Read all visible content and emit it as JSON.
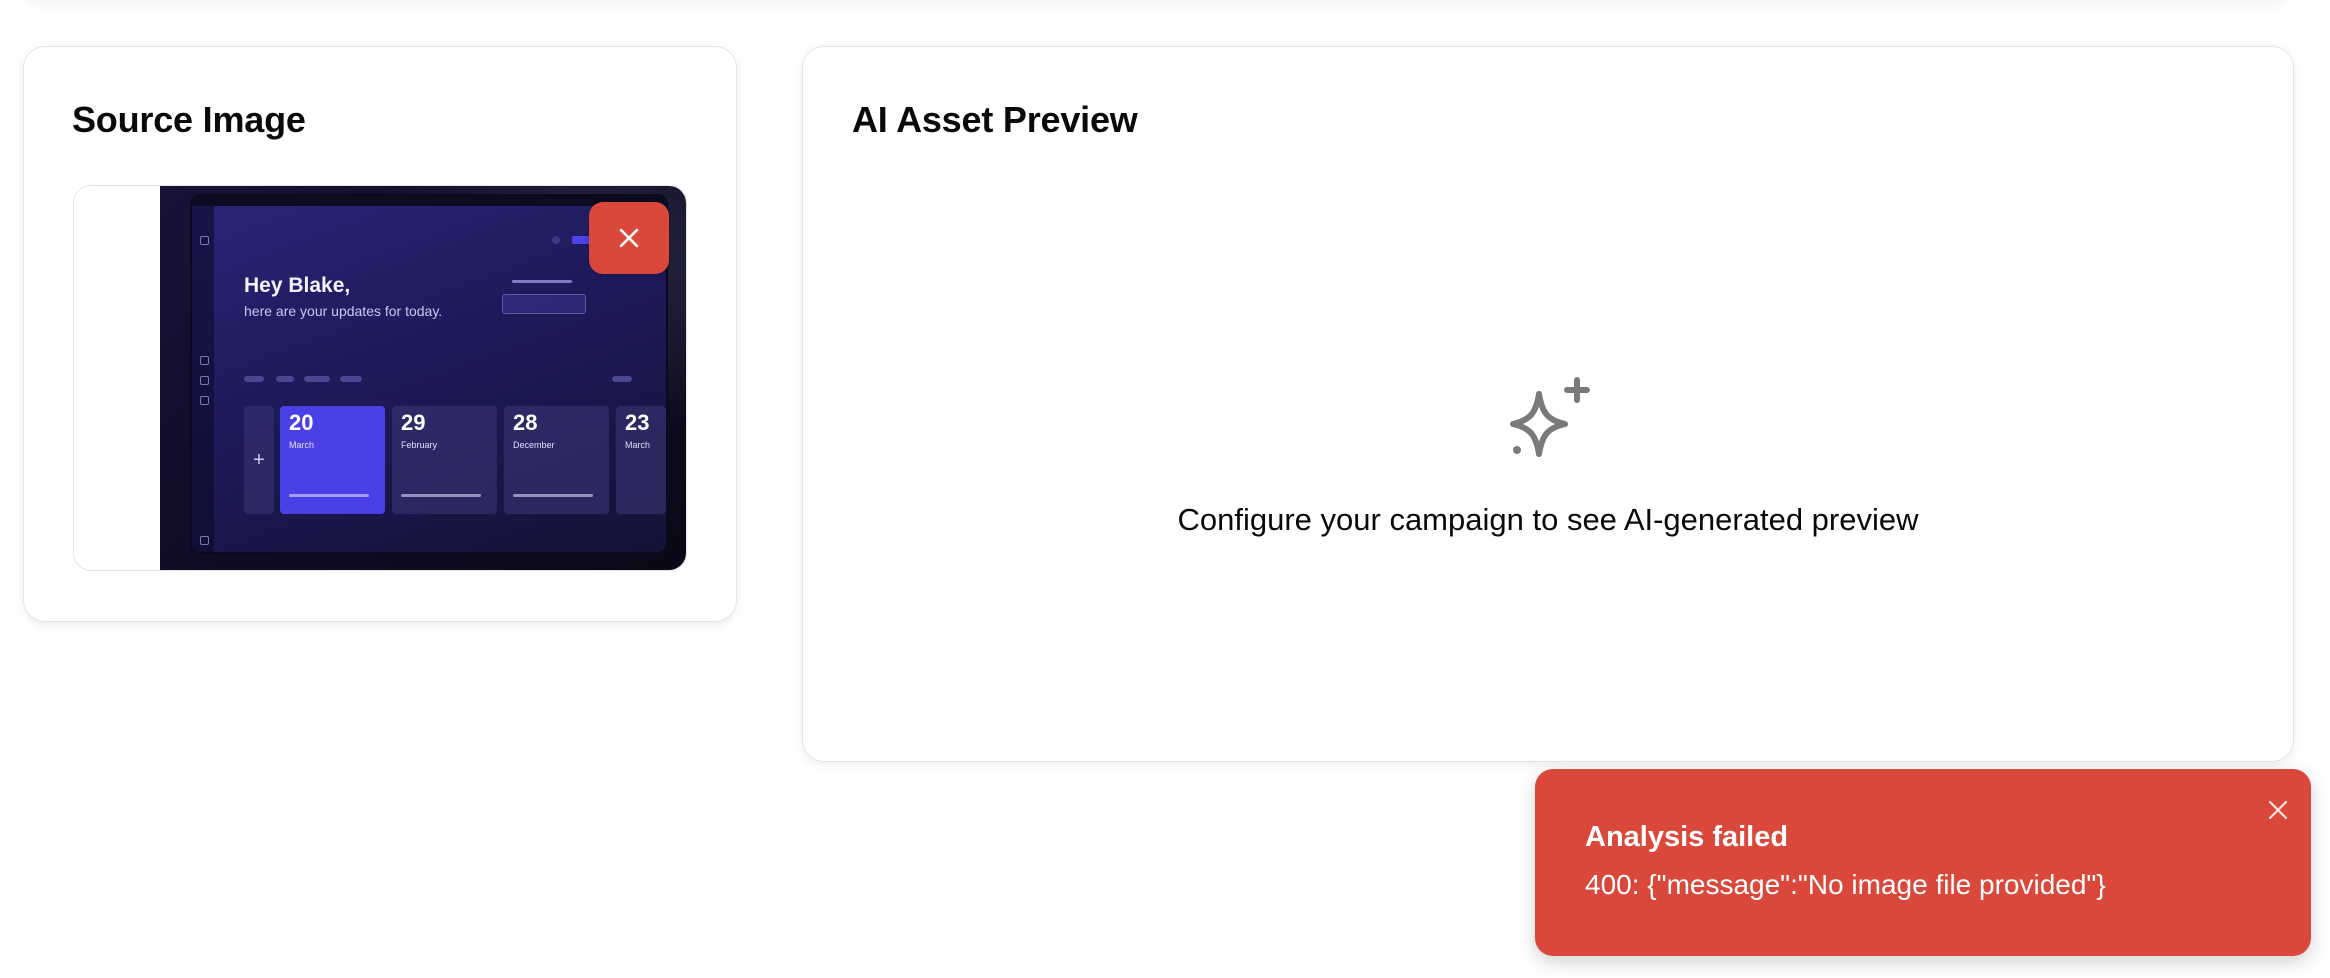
{
  "source_card": {
    "title": "Source Image",
    "thumbnail": {
      "greeting": "Hey Blake,",
      "subtitle": "here are your updates for today.",
      "dates": [
        {
          "day": "20",
          "month": "March"
        },
        {
          "day": "29",
          "month": "February"
        },
        {
          "day": "28",
          "month": "December"
        },
        {
          "day": "23",
          "month": "March"
        }
      ]
    },
    "remove_icon": "close-icon"
  },
  "preview_card": {
    "title": "AI Asset Preview",
    "empty_icon": "sparkle-icon",
    "empty_message": "Configure your campaign to see AI-generated preview"
  },
  "toast": {
    "title": "Analysis failed",
    "message": "400: {\"message\":\"No image file provided\"}",
    "close_icon": "close-icon"
  },
  "colors": {
    "danger": "#d9483b",
    "card_border": "#e4e4e7",
    "icon_gray": "#7a7a7a"
  }
}
